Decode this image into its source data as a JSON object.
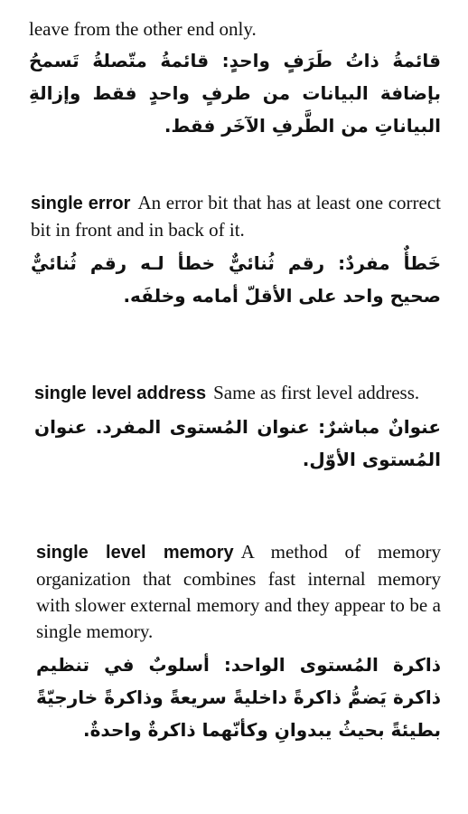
{
  "entries": [
    {
      "term": "",
      "definition_en": "leave from the other end only.",
      "definition_ar": "قائمةُ ذاتُ طَرَفٍ واحدٍ: قائمةُ متّصلةُ تَسمحُ بإضافة البيانات من طرفٍ واحدٍ فقط وإزالةِ البياناتِ من الطَّرفِ الآخَر فقط."
    },
    {
      "term": "single error",
      "definition_en": "An error bit that has at least one correct bit in front and in back of it.",
      "definition_ar": "خَطأٌ مفردٌ: رقم ثُنائيٌّ خطأ لـه رقم ثُنائيٌّ صحيح واحد على الأقلّ أمامه وخلفَه."
    },
    {
      "term": "single level address",
      "definition_en": "Same as first level address.",
      "definition_ar": "عنوانٌ مباشرٌ: عنوان المُستوى المفرد. عنوان المُستوى الأوّل."
    },
    {
      "term": "single level memory",
      "definition_en": "A method of memory organization that combines fast internal memory with slower external memory and they appear to be a single memory.",
      "definition_ar": "ذاكرة المُستوى الواحد: أسلوبٌ في تنظيم ذاكرة يَضمُّ ذاكرةً داخليةً سريعةً وذاكرةً خارجيّةً بطيئةً بحيثُ يبدوانِ وكأنّهما ذاكرةٌ واحدةٌ."
    }
  ]
}
